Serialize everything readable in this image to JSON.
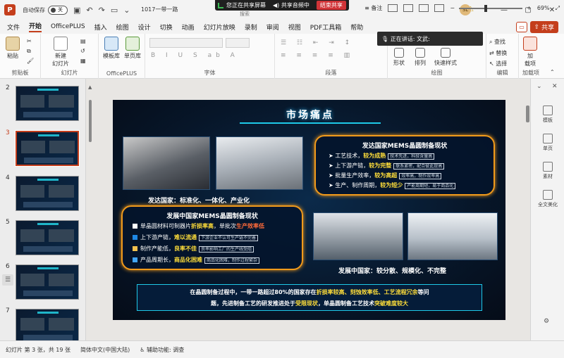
{
  "titlebar": {
    "autosave_label": "自动保存",
    "autosave_state": "关",
    "doc_name": "1017一带一路",
    "search_text": "搜索",
    "user_initials": "SL"
  },
  "screenshare": {
    "sharing_text": "您正在共享屏幕",
    "audio_text": "共享音频中",
    "stop_text": "结束共享"
  },
  "menu": {
    "items": [
      "文件",
      "开始",
      "OfficePLUS",
      "插入",
      "绘图",
      "设计",
      "切换",
      "动画",
      "幻灯片放映",
      "录制",
      "审阅",
      "视图",
      "PDF工具箱",
      "帮助"
    ],
    "active": "开始",
    "share_label": "共享"
  },
  "speaking_banner": "正在讲话: 文武:",
  "ribbon": {
    "clipboard": {
      "label": "剪贴板",
      "paste": "粘贴"
    },
    "slides": {
      "label": "幻灯片",
      "new_slide": "新建\n幻灯片"
    },
    "officeplus": {
      "label": "OfficePLUS",
      "template": "模板库",
      "single": "单页库"
    },
    "font": {
      "label": "字体"
    },
    "paragraph": {
      "label": "段落"
    },
    "drawing": {
      "label": "绘图",
      "shape": "形状",
      "arrange": "排列",
      "quickstyle": "快速样式"
    },
    "editing": {
      "label": "编辑",
      "find": "查找",
      "replace": "替换",
      "select": "选择"
    },
    "addins": {
      "label": "加载项",
      "btn": "加\n载项"
    }
  },
  "slides_panel": {
    "numbers": [
      "2",
      "3",
      "4",
      "5",
      "6",
      "7"
    ],
    "selected": "3"
  },
  "slide": {
    "title": "市场痛点",
    "caption_developed": "发达国家：标准化、一体化、产业化",
    "caption_developing": "发展中国家：较分散、规模化、不完整",
    "developed_panel": {
      "heading": "发达国家MEMS晶圆制备现状",
      "items": [
        {
          "pre": "工艺技术，",
          "hl": "较为成熟",
          "note": "技术先进，科技含量高"
        },
        {
          "pre": "上下游产链，",
          "hl": "较为完整",
          "note": "联系紧密，配合彼此提高"
        },
        {
          "pre": "批量生产效率，",
          "hl": "较为高超",
          "note": "效率高，制作效率高"
        },
        {
          "pre": "生产、制作周期，",
          "hl": "较为短少",
          "note": "产能周期短，易于商品化"
        }
      ]
    },
    "developing_panel": {
      "heading": "发展中国家MEMS晶圆制备现状",
      "items": [
        {
          "pre": "单晶圆材料可制器片",
          "hl": "折损率高",
          "post": "，单批次",
          "hl2": "生产效率低"
        },
        {
          "pre": "上下游产链，",
          "hl": "难以流通",
          "note": "下游企业不认可生产链不完善"
        },
        {
          "pre": "制作产能低，",
          "hl": "良率不佳",
          "note": "良率影响工厂的生产线受阻"
        },
        {
          "pre": "产品周期长，",
          "hl": "商品化困难",
          "note": "商品化困难，制作过程繁杂"
        }
      ]
    },
    "bottom": {
      "line1_a": "在晶圆制备过程中，一带一路超过80%的国家存在",
      "line1_hl": "折损率较高、刻蚀效率低、工艺流程冗余",
      "line1_b": "等问",
      "line2_a": "题，先进制备工艺的研发推进处于",
      "line2_hl": "受限现状",
      "line2_b": "，单晶圆制备工艺技术",
      "line2_hl2": "突破难度较大"
    }
  },
  "right_panel": {
    "items": [
      "模板",
      "单页",
      "素材",
      "全文美化"
    ]
  },
  "status": {
    "slide_info": "幻灯片 第 3 张，共 19 张",
    "language": "简体中文(中国大陆)",
    "accessibility": "辅助功能: 调查",
    "notes": "备注",
    "zoom": "69%"
  },
  "colors": {
    "accent": "#c43e1c",
    "highlight": "#ffde3a",
    "panel_border": "#f19a1b",
    "cyan": "#1ec9e8"
  }
}
